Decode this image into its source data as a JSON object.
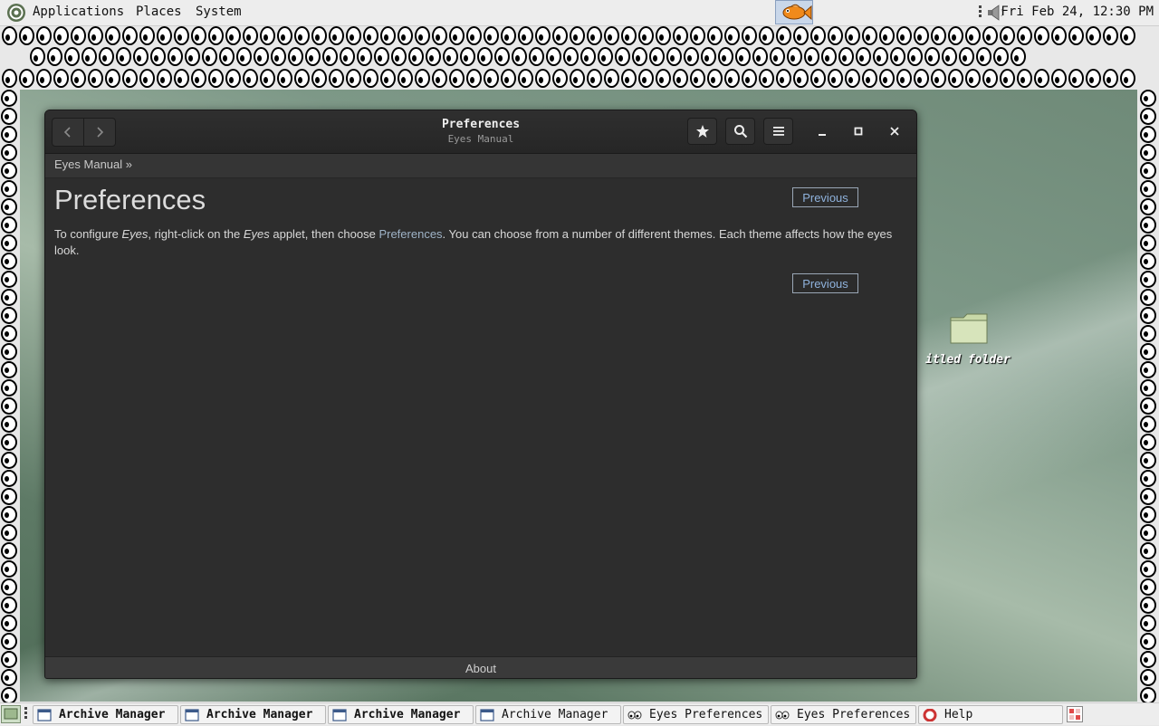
{
  "top_panel": {
    "menus": [
      "Applications",
      "Places",
      "System"
    ],
    "clock": "Fri Feb 24, 12:30 PM",
    "icons": {
      "menu": "distro-logo-icon",
      "launcher": "fish-icon",
      "volume": "speaker-icon"
    }
  },
  "desktop": {
    "folder_label": "itled folder"
  },
  "window": {
    "title": "Preferences",
    "subtitle": "Eyes Manual",
    "breadcrumb": "Eyes Manual »",
    "page_title": "Preferences",
    "prev_label": "Previous",
    "paragraph": {
      "t1": "To configure ",
      "em1": "Eyes",
      "t2": ", right-click on the ",
      "em2": "Eyes",
      "t3": " applet, then choose ",
      "link": "Preferences",
      "t4": ". You can choose from a number of different themes. Each theme affects how the eyes look."
    },
    "footer": "About"
  },
  "taskbar": {
    "tasks": [
      {
        "label": "Archive Manager",
        "icon": "window-icon",
        "bold": true
      },
      {
        "label": "Archive Manager",
        "icon": "window-icon",
        "bold": true
      },
      {
        "label": "Archive Manager",
        "icon": "window-icon",
        "bold": true
      },
      {
        "label": "Archive Manager",
        "icon": "window-icon",
        "bold": false
      },
      {
        "label": "Eyes Preferences",
        "icon": "eyes-icon",
        "bold": false
      },
      {
        "label": "Eyes Preferences",
        "icon": "eyes-icon",
        "bold": false
      },
      {
        "label": "Help",
        "icon": "help-lifebuoy-icon",
        "bold": false
      }
    ]
  }
}
